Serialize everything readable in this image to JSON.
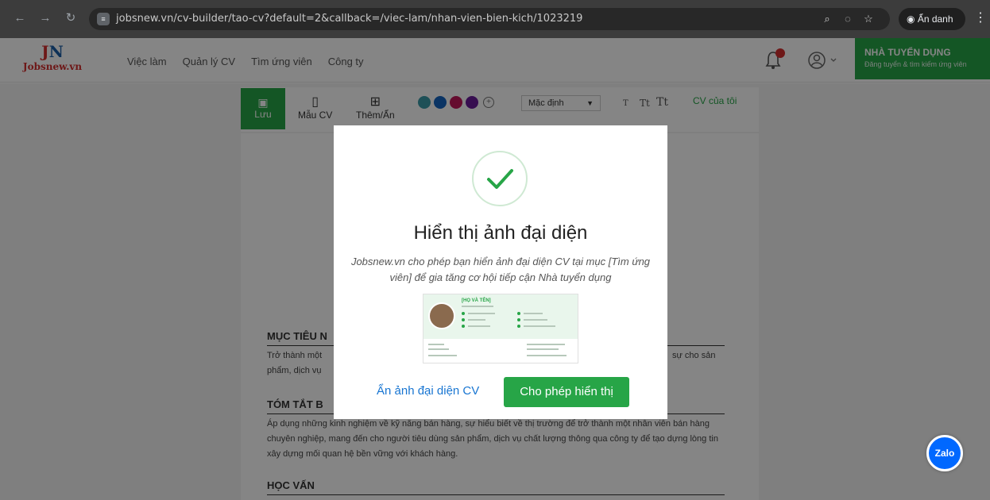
{
  "browser": {
    "url": "jobsnew.vn/cv-builder/tao-cv?default=2&callback=/viec-lam/nhan-vien-bien-kich/1023219",
    "incognito_label": "Ẩn danh"
  },
  "header": {
    "logo_mark": "N",
    "logo_mark_prefix": "J",
    "logo_text": "Jobsnew.vn",
    "nav": [
      "Việc làm",
      "Quản lý CV",
      "Tìm ứng viên",
      "Công ty"
    ],
    "employer_title": "NHÀ TUYỂN DỤNG",
    "employer_subtitle": "Đăng tuyển & tìm kiếm ứng viên"
  },
  "toolbar": {
    "save_label": "Lưu",
    "template_label": "Mẫu CV",
    "toggle_label": "Thêm/Ẩn",
    "colors": [
      "#3a9aa8",
      "#1565c0",
      "#c2185b",
      "#6a1b9a"
    ],
    "font_select": "Mặc định",
    "text_sizes": [
      "T",
      "Tt",
      "Tt"
    ],
    "my_cv_label": "CV của tôi"
  },
  "cv": {
    "objective_heading": "MỤC TIÊU N",
    "objective_text_left": "Trở thành một",
    "objective_text_right": "sự cho sản",
    "objective_text_line2": "phẩm, dịch vụ",
    "summary_heading": "TÓM TẮT B",
    "summary_text": "Áp dụng những kinh nghiệm về kỹ năng bán hàng, sự hiểu biết về thị trường để trở thành một nhân viên bán hàng chuyên nghiệp, mang đến cho người tiêu dùng sản phẩm, dịch vụ chất lượng thông qua công ty để tạo dựng lòng tin xây dựng mối quan hệ bền vững với khách hàng.",
    "education_heading": "HỌC VẤN"
  },
  "zalo_label": "Zalo",
  "modal": {
    "title": "Hiển thị ảnh đại diện",
    "description": "Jobsnew.vn cho phép bạn hiển ảnh đại diện CV tại mục [Tìm ứng viên] để gia tăng cơ hội tiếp cận Nhà tuyển dụng",
    "preview_name": "[HỌ VÀ TÊN]",
    "hide_button": "Ẩn ảnh đại diện CV",
    "allow_button": "Cho phép hiển thị"
  },
  "colors": {
    "brand_green": "#27a547",
    "link_blue": "#1976d2",
    "logo_red": "#d32f2f"
  }
}
